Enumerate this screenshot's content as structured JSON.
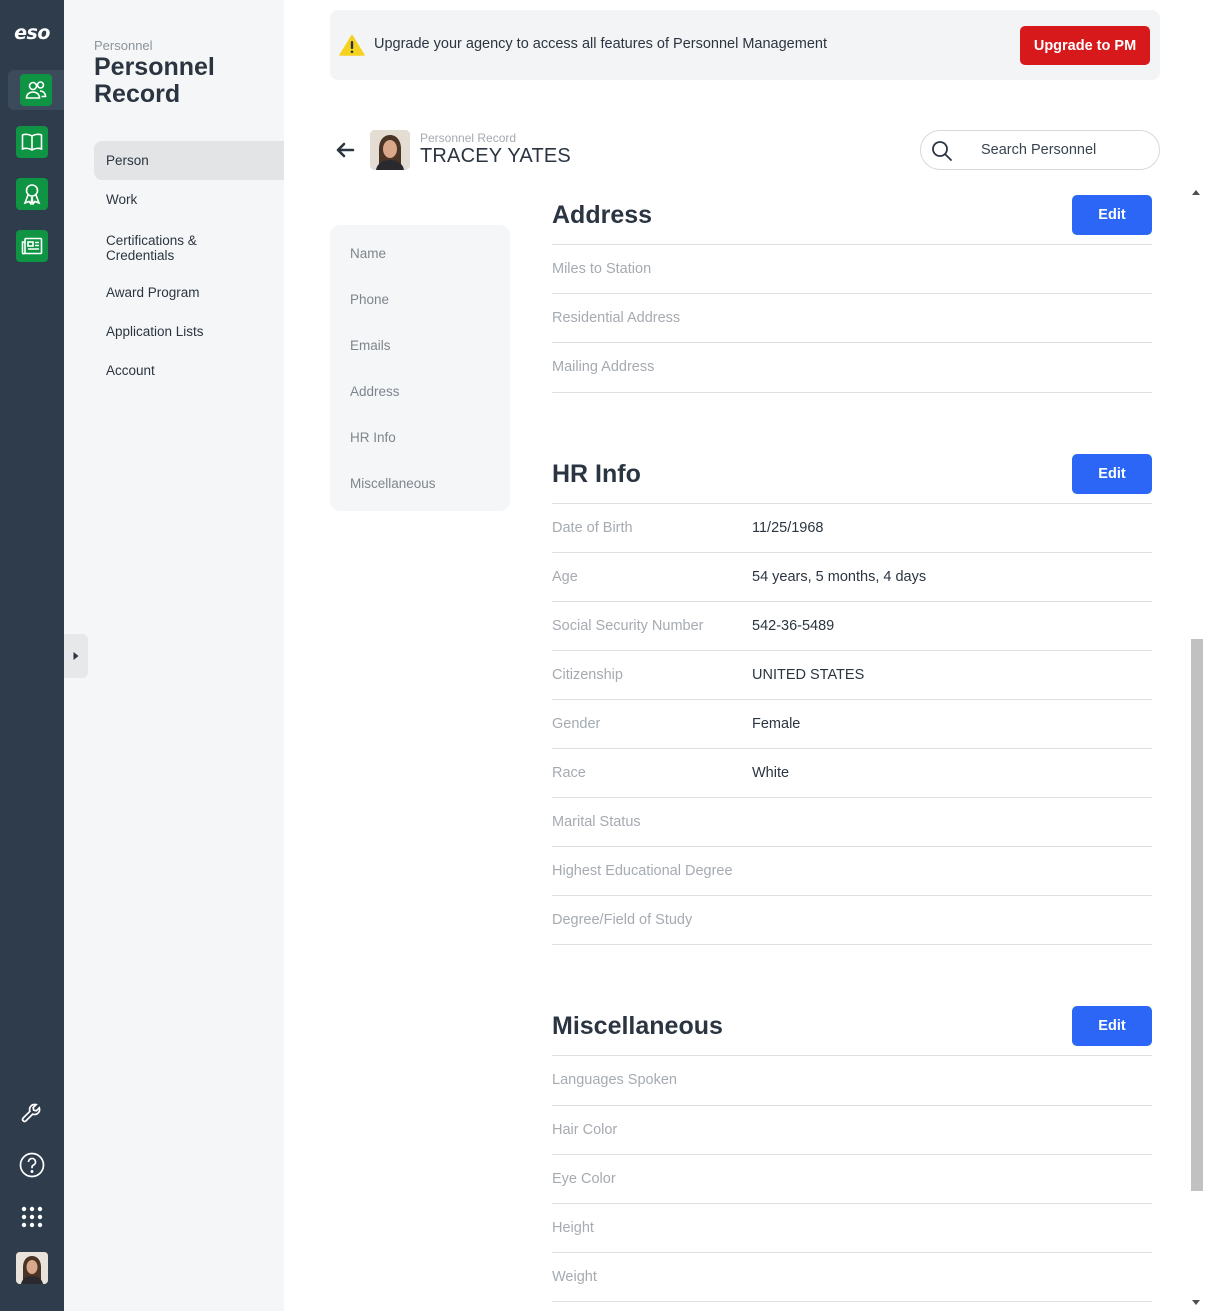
{
  "app": {
    "logo": "eso"
  },
  "rail": {
    "icons": [
      "personnel-icon",
      "book-icon",
      "award-ribbon-icon",
      "news-icon"
    ],
    "bottom_icons": [
      "wrench-icon",
      "help-icon",
      "app-grid-icon",
      "user-avatar"
    ],
    "accent_color": "#0e9443"
  },
  "nav_panel": {
    "kicker": "Personnel",
    "title": "Personnel Record",
    "items": [
      {
        "label": "Person",
        "active": true
      },
      {
        "label": "Work"
      },
      {
        "label": "Certifications & Credentials"
      },
      {
        "label": "Award Program"
      },
      {
        "label": "Application Lists"
      },
      {
        "label": "Account"
      }
    ]
  },
  "banner": {
    "message": "Upgrade your agency to access all features of Personnel Management",
    "button_label": "Upgrade to PM",
    "button_color": "#d7191c",
    "icon": "warning-icon"
  },
  "header": {
    "kicker": "Personnel Record",
    "name": "TRACEY YATES"
  },
  "search": {
    "placeholder": "Search Personnel"
  },
  "subnav": {
    "items": [
      "Name",
      "Phone",
      "Emails",
      "Address",
      "HR Info",
      "Miscellaneous"
    ]
  },
  "sections": {
    "address": {
      "title": "Address",
      "edit_label": "Edit",
      "rows": [
        {
          "label": "Miles to Station",
          "value": ""
        },
        {
          "label": "Residential Address",
          "value": ""
        },
        {
          "label": "Mailing Address",
          "value": ""
        }
      ]
    },
    "hr_info": {
      "title": "HR Info",
      "edit_label": "Edit",
      "rows": [
        {
          "label": "Date of Birth",
          "value": "11/25/1968"
        },
        {
          "label": "Age",
          "value": "54 years, 5 months, 4 days"
        },
        {
          "label": "Social Security Number",
          "value": "542-36-5489"
        },
        {
          "label": "Citizenship",
          "value": "UNITED STATES"
        },
        {
          "label": "Gender",
          "value": "Female"
        },
        {
          "label": "Race",
          "value": "White"
        },
        {
          "label": "Marital Status",
          "value": ""
        },
        {
          "label": "Highest Educational Degree",
          "value": ""
        },
        {
          "label": "Degree/Field of Study",
          "value": ""
        }
      ]
    },
    "miscellaneous": {
      "title": "Miscellaneous",
      "edit_label": "Edit",
      "rows": [
        {
          "label": "Languages Spoken",
          "value": ""
        },
        {
          "label": "Hair Color",
          "value": ""
        },
        {
          "label": "Eye Color",
          "value": ""
        },
        {
          "label": "Height",
          "value": ""
        },
        {
          "label": "Weight",
          "value": ""
        }
      ]
    }
  },
  "colors": {
    "edit_button": "#2b66f6",
    "rail_bg": "#2e3c4c"
  }
}
